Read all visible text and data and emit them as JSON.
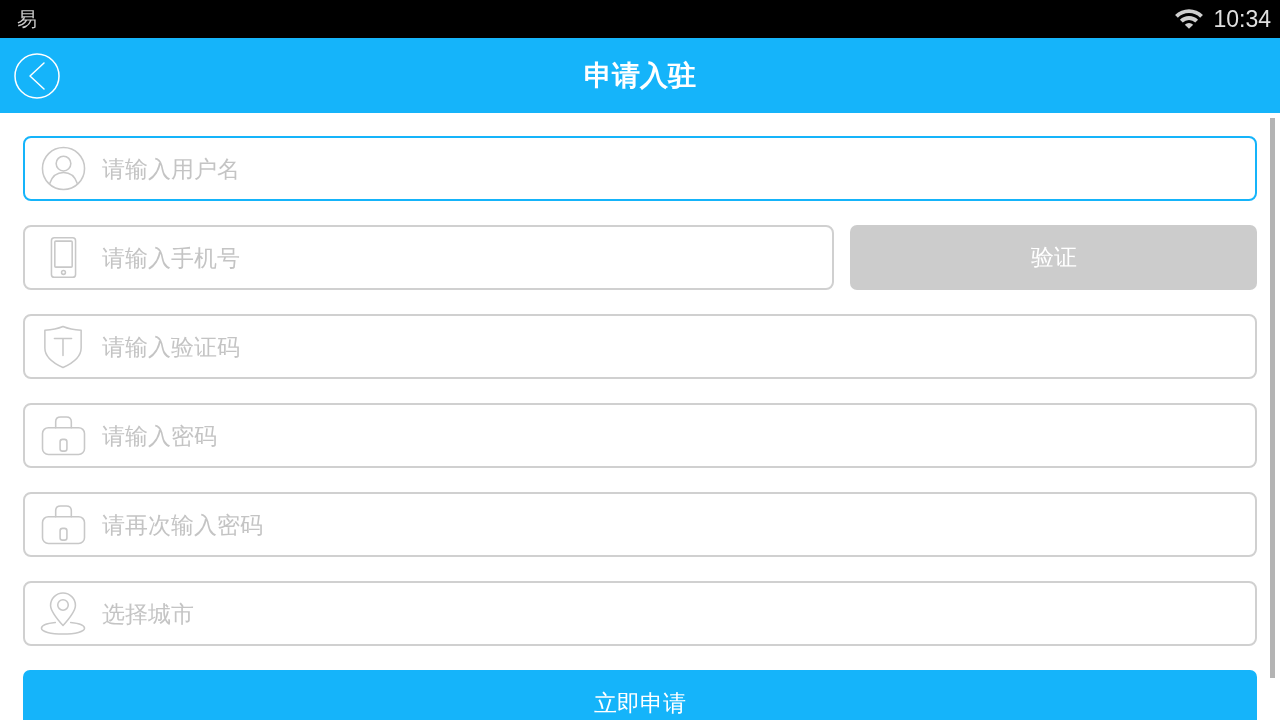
{
  "status_bar": {
    "notification": "易",
    "time": "10:34"
  },
  "app_bar": {
    "title": "申请入驻"
  },
  "form": {
    "fields": [
      {
        "placeholder": "请输入用户名",
        "focused": true
      },
      {
        "placeholder": "请输入手机号",
        "focused": false,
        "button": {
          "label": "验证",
          "disabled": true
        }
      },
      {
        "placeholder": "请输入验证码",
        "focused": false
      },
      {
        "placeholder": "请输入密码",
        "focused": false
      },
      {
        "placeholder": "请再次输入密码",
        "focused": false
      },
      {
        "placeholder": "选择城市",
        "focused": false
      }
    ],
    "submit_button": {
      "label": "立即申请"
    }
  }
}
